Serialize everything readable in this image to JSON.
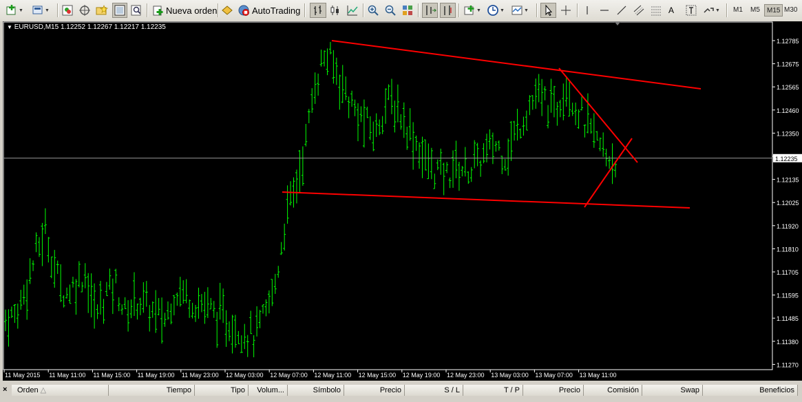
{
  "toolbar": {
    "new_order_label": "Nueva orden",
    "autotrading_label": "AutoTrading",
    "timeframes": [
      "M1",
      "M5",
      "M15",
      "M30"
    ],
    "active_timeframe": "M15",
    "text_tool": "A"
  },
  "chart": {
    "symbol_info": "EURUSD,M15  1.12252 1.12267 1.12217 1.12235",
    "price_labels": [
      "1.12785",
      "1.12675",
      "1.12565",
      "1.12460",
      "1.12350",
      "1.12235",
      "1.12135",
      "1.12025",
      "1.11920",
      "1.11810",
      "1.11705",
      "1.11595",
      "1.11485",
      "1.11380",
      "1.11270"
    ],
    "current_price": "1.12235",
    "time_labels": [
      "11 May 2015",
      "11 May 11:00",
      "11 May 15:00",
      "11 May 19:00",
      "11 May 23:00",
      "12 May 03:00",
      "12 May 07:00",
      "12 May 11:00",
      "12 May 15:00",
      "12 May 19:00",
      "12 May 23:00",
      "13 May 03:00",
      "13 May 07:00",
      "13 May 11:00"
    ],
    "colors": {
      "background": "#000000",
      "bars": "#00ff00",
      "trendlines": "#ff0000",
      "grid_text": "#ffffff"
    }
  },
  "chart_data": {
    "type": "bar",
    "title": "EURUSD,M15",
    "ylim": [
      1.1122,
      1.1285
    ],
    "series": [
      {
        "name": "EURUSD",
        "values": [
          1.1148,
          1.115,
          1.1162,
          1.1178,
          1.119,
          1.117,
          1.116,
          1.1165,
          1.117,
          1.115,
          1.116,
          1.1165,
          1.115,
          1.1158,
          1.1155,
          1.115,
          1.1148,
          1.1162,
          1.116,
          1.1156,
          1.1155,
          1.115,
          1.1148,
          1.1145,
          1.1142,
          1.114,
          1.115,
          1.1165,
          1.1195,
          1.121,
          1.123,
          1.126,
          1.1272,
          1.1265,
          1.1255,
          1.1245,
          1.124,
          1.1235,
          1.125,
          1.1248,
          1.124,
          1.1232,
          1.1222,
          1.1218,
          1.1215,
          1.122,
          1.1218,
          1.122,
          1.1225,
          1.123,
          1.1225,
          1.1235,
          1.1245,
          1.1252,
          1.125,
          1.1245,
          1.126,
          1.1248,
          1.124,
          1.1232,
          1.1225,
          1.1223
        ]
      }
    ]
  },
  "terminal": {
    "close": "×",
    "columns": [
      "Orden",
      "Tiempo",
      "Tipo",
      "Volum...",
      "Símbolo",
      "Precio",
      "S / L",
      "T / P",
      "Precio",
      "Comisión",
      "Swap",
      "Beneficios"
    ]
  }
}
